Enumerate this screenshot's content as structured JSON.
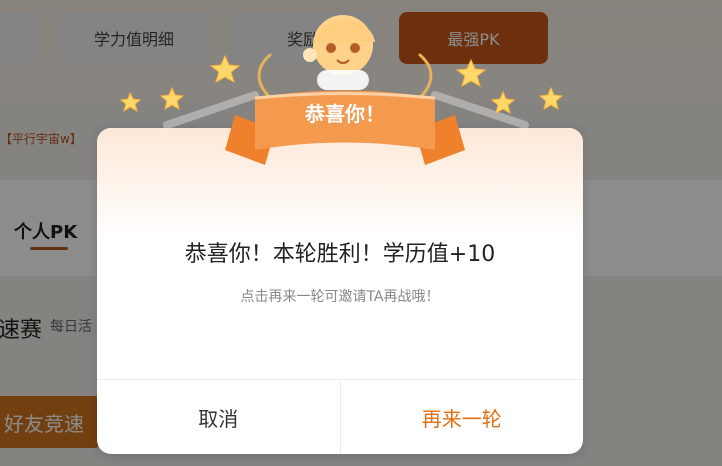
{
  "top_nav": {
    "items": [
      {
        "label": "",
        "active": false
      },
      {
        "label": "学力值明细",
        "active": false
      },
      {
        "label": "奖励",
        "active": false
      },
      {
        "label": "最强PK",
        "active": true
      }
    ]
  },
  "background": {
    "history_label": "【平行宇宙w】",
    "personal_tab": "个人PK",
    "race_title": "速赛",
    "daily_label": "每日活",
    "friend_button": "好友竞速"
  },
  "dialog": {
    "banner": "恭喜你！",
    "message": "恭喜你！本轮胜利！学历值+10",
    "subtext": "点击再来一轮可邀请TA再战哦！",
    "buttons": {
      "cancel": "取消",
      "again": "再来一轮"
    },
    "colors": {
      "accent": "#e06f12",
      "ribbon": "#f39a4f"
    }
  },
  "icons": {
    "star": "star-icon",
    "laurel": "laurel-icon",
    "avatar": "mascot-avatar"
  }
}
